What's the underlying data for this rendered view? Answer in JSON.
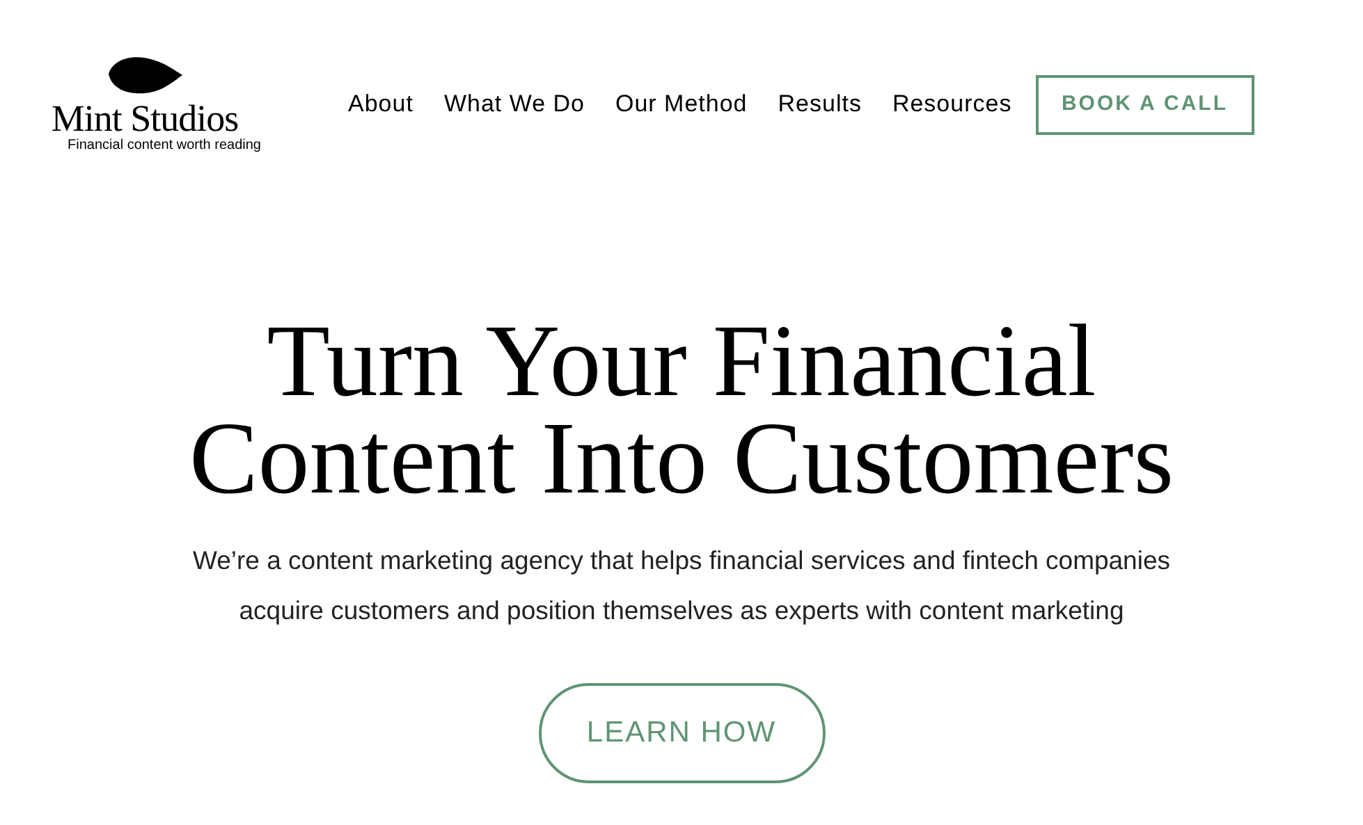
{
  "logo": {
    "name": "Mint Studios",
    "tagline": "Financial content worth reading"
  },
  "nav": [
    {
      "label": "About"
    },
    {
      "label": "What We Do"
    },
    {
      "label": "Our Method"
    },
    {
      "label": "Results"
    },
    {
      "label": "Resources"
    }
  ],
  "cta_button": "BOOK A CALL",
  "hero": {
    "title_lines": [
      "Turn Your Financial",
      "Content Into Customers"
    ],
    "subtitle_lines": [
      "We’re a content marketing agency that helps financial services and fintech companies",
      "acquire customers and position themselves as experts with content marketing"
    ],
    "button": "LEARN HOW"
  }
}
